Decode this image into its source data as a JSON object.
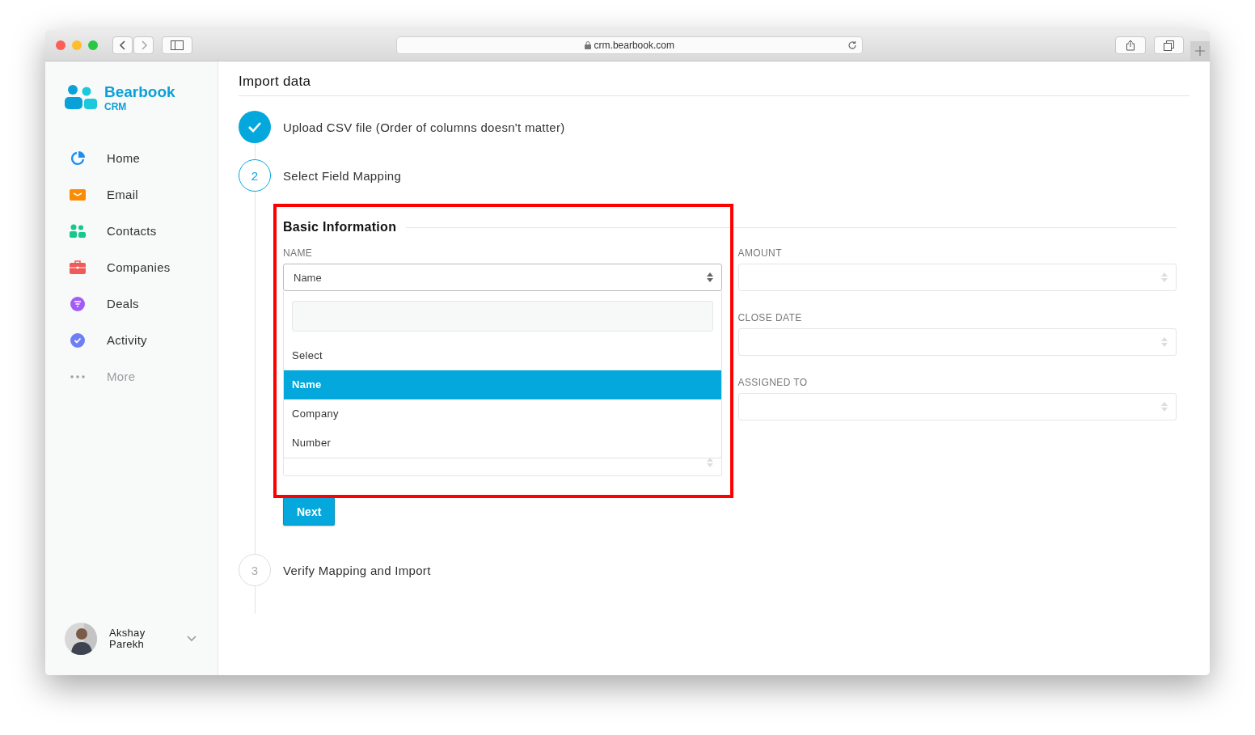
{
  "browser": {
    "url": "crm.bearbook.com"
  },
  "brand": {
    "name": "Bearbook",
    "sub": "CRM"
  },
  "sidebar": {
    "items": [
      {
        "kind": "home",
        "label": "Home",
        "disabled": false
      },
      {
        "kind": "email",
        "label": "Email",
        "disabled": false
      },
      {
        "kind": "contacts",
        "label": "Contacts",
        "disabled": false
      },
      {
        "kind": "companies",
        "label": "Companies",
        "disabled": false
      },
      {
        "kind": "deals",
        "label": "Deals",
        "disabled": false
      },
      {
        "kind": "activity",
        "label": "Activity",
        "disabled": false
      },
      {
        "kind": "more",
        "label": "More",
        "disabled": true
      }
    ],
    "user": {
      "first": "Akshay",
      "last": "Parekh"
    }
  },
  "page": {
    "title": "Import data"
  },
  "steps": [
    {
      "kind": "done",
      "title": "Upload CSV file (Order of columns doesn't matter)"
    },
    {
      "kind": "current",
      "number": "2",
      "title": "Select Field Mapping"
    },
    {
      "kind": "pending",
      "number": "3",
      "title": "Verify Mapping and Import"
    }
  ],
  "form": {
    "section": "Basic Information",
    "name_field": {
      "label": "NAME",
      "value": "Name",
      "options": [
        {
          "label": "Select",
          "selected": false
        },
        {
          "label": "Name",
          "selected": true
        },
        {
          "label": "Company",
          "selected": false
        },
        {
          "label": "Number",
          "selected": false
        }
      ]
    },
    "right_fields": [
      {
        "label": "AMOUNT"
      },
      {
        "label": "CLOSE DATE"
      },
      {
        "label": "ASSIGNED TO"
      }
    ],
    "button": "Next"
  }
}
